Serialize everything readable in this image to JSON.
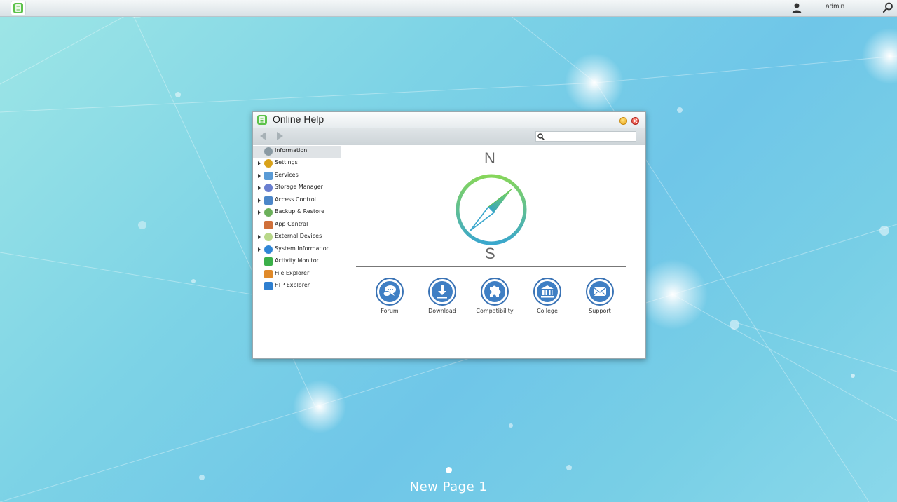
{
  "topbar": {
    "user_name": "admin"
  },
  "window": {
    "title": "Online Help",
    "search": {
      "value": "",
      "placeholder": ""
    },
    "sidebar": {
      "items": [
        {
          "label": "Information",
          "icon": "compass-icon",
          "expandable": false,
          "selected": true,
          "color": "#8a9aa3"
        },
        {
          "label": "Settings",
          "icon": "gear-icon",
          "expandable": true,
          "selected": false,
          "color": "#d9a21a"
        },
        {
          "label": "Services",
          "icon": "services-icon",
          "expandable": true,
          "selected": false,
          "color": "#5a9bd6"
        },
        {
          "label": "Storage Manager",
          "icon": "storage-icon",
          "expandable": true,
          "selected": false,
          "color": "#6a7fd0"
        },
        {
          "label": "Access Control",
          "icon": "id-card-icon",
          "expandable": true,
          "selected": false,
          "color": "#4b86c8"
        },
        {
          "label": "Backup & Restore",
          "icon": "backup-icon",
          "expandable": true,
          "selected": false,
          "color": "#6bb05a"
        },
        {
          "label": "App Central",
          "icon": "house-icon",
          "expandable": false,
          "selected": false,
          "color": "#d0703a"
        },
        {
          "label": "External Devices",
          "icon": "usb-icon",
          "expandable": true,
          "selected": false,
          "color": "#b9d88a"
        },
        {
          "label": "System Information",
          "icon": "info-icon",
          "expandable": true,
          "selected": false,
          "color": "#2f86d6"
        },
        {
          "label": "Activity Monitor",
          "icon": "monitor-icon",
          "expandable": false,
          "selected": false,
          "color": "#3bb04a"
        },
        {
          "label": "File Explorer",
          "icon": "folder-icon",
          "expandable": false,
          "selected": false,
          "color": "#e08a2a"
        },
        {
          "label": "FTP Explorer",
          "icon": "ftp-icon",
          "expandable": false,
          "selected": false,
          "color": "#2f7fd0"
        }
      ]
    },
    "content": {
      "north": "N",
      "south": "S",
      "links": [
        {
          "label": "Forum",
          "icon": "chat-bubbles-icon"
        },
        {
          "label": "Download",
          "icon": "download-icon"
        },
        {
          "label": "Compatibility",
          "icon": "puzzle-icon"
        },
        {
          "label": "College",
          "icon": "building-icon"
        },
        {
          "label": "Support",
          "icon": "envelope-icon"
        }
      ]
    }
  },
  "desktop": {
    "page_label": "New Page 1"
  },
  "colors": {
    "accent_blue": "#3f7fc4",
    "compass_green": "#7cd35a",
    "compass_teal": "#3aa9c9"
  }
}
